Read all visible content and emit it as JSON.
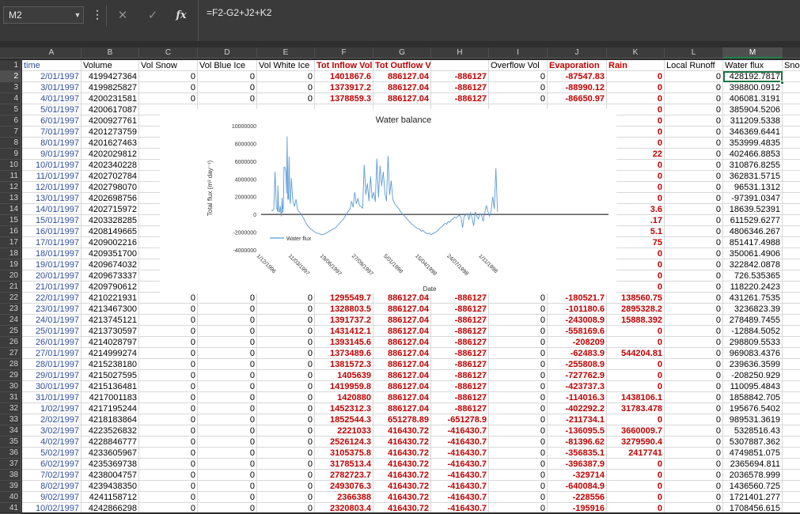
{
  "formula_bar": {
    "name_box": "M2",
    "more_icon": "ellipsis-vertical-icon",
    "cancel_icon": "cross-icon",
    "enter_icon": "check-icon",
    "fx_label": "fx",
    "formula": "=F2-G2+J2+K2"
  },
  "columns": [
    "A",
    "B",
    "C",
    "D",
    "E",
    "F",
    "G",
    "H",
    "I",
    "J",
    "K",
    "L",
    "M",
    ""
  ],
  "selected_column": "M",
  "headers": [
    "time",
    "Volume",
    "Vol Snow",
    "Vol Blue Ice",
    "Vol White Ice",
    "Tot Inflow Vol",
    "Tot Outflow Vol",
    "",
    "Overflow Vol",
    "Evaporation",
    "Rain",
    "Local Runoff",
    "Water flux",
    "Sno"
  ],
  "rows": [
    {
      "n": "2",
      "c": [
        "2/01/1997",
        "4199427364",
        "0",
        "0",
        "0",
        "1401867.6",
        "886127.04",
        "-886127",
        "0",
        "-87547.83",
        "0",
        "0",
        "428192.7817"
      ]
    },
    {
      "n": "3",
      "c": [
        "3/01/1997",
        "4199825827",
        "0",
        "0",
        "0",
        "1373917.2",
        "886127.04",
        "-886127",
        "0",
        "-88990.12",
        "0",
        "0",
        "398800.0912"
      ]
    },
    {
      "n": "4",
      "c": [
        "4/01/1997",
        "4200231581",
        "0",
        "0",
        "0",
        "1378859.3",
        "886127.04",
        "-886127",
        "0",
        "-86650.97",
        "0",
        "0",
        "406081.3191"
      ]
    },
    {
      "n": "5",
      "c": [
        "5/01/1997",
        "4200617087",
        "",
        "",
        "",
        "",
        "",
        "",
        "",
        "",
        "0",
        "0",
        "385904.5206"
      ]
    },
    {
      "n": "6",
      "c": [
        "6/01/1997",
        "4200927761",
        "",
        "",
        "",
        "",
        "",
        "",
        "",
        "",
        "0",
        "0",
        "311209.5338"
      ]
    },
    {
      "n": "7",
      "c": [
        "7/01/1997",
        "4201273759",
        "",
        "",
        "",
        "",
        "",
        "",
        "",
        "",
        "0",
        "0",
        "346369.6441"
      ]
    },
    {
      "n": "8",
      "c": [
        "8/01/1997",
        "4201627463",
        "",
        "",
        "",
        "",
        "",
        "",
        "",
        "",
        "0",
        "0",
        "353999.4835"
      ]
    },
    {
      "n": "9",
      "c": [
        "9/01/1997",
        "4202029812",
        "",
        "",
        "",
        "",
        "",
        "",
        "",
        "",
        "22",
        "0",
        "402466.8853"
      ]
    },
    {
      "n": "10",
      "c": [
        "10/01/1997",
        "4202340228",
        "",
        "",
        "",
        "",
        "",
        "",
        "",
        "",
        "0",
        "0",
        "310876.8255"
      ]
    },
    {
      "n": "11",
      "c": [
        "11/01/1997",
        "4202702784",
        "",
        "",
        "",
        "",
        "",
        "",
        "",
        "",
        "0",
        "0",
        "362831.5715"
      ]
    },
    {
      "n": "12",
      "c": [
        "12/01/1997",
        "4202798070",
        "",
        "",
        "",
        "",
        "",
        "",
        "",
        "",
        "0",
        "0",
        "96531.1312"
      ]
    },
    {
      "n": "13",
      "c": [
        "13/01/1997",
        "4202698756",
        "",
        "",
        "",
        "",
        "",
        "",
        "",
        "",
        "0",
        "0",
        "-97391.0347"
      ]
    },
    {
      "n": "14",
      "c": [
        "14/01/1997",
        "4202715972",
        "",
        "",
        "",
        "",
        "",
        "",
        "",
        "",
        "3.6",
        "0",
        "18639.52391"
      ]
    },
    {
      "n": "15",
      "c": [
        "15/01/1997",
        "4203328285",
        "",
        "",
        "",
        "",
        "",
        "",
        "",
        "",
        ".17",
        "0",
        "611529.6277"
      ]
    },
    {
      "n": "16",
      "c": [
        "16/01/1997",
        "4208149665",
        "",
        "",
        "",
        "",
        "",
        "",
        "",
        "",
        "5.1",
        "0",
        "4806346.267"
      ]
    },
    {
      "n": "17",
      "c": [
        "17/01/1997",
        "4209002216",
        "",
        "",
        "",
        "",
        "",
        "",
        "",
        "",
        "75",
        "0",
        "851417.4988"
      ]
    },
    {
      "n": "18",
      "c": [
        "18/01/1997",
        "4209351700",
        "",
        "",
        "",
        "",
        "",
        "",
        "",
        "",
        "0",
        "0",
        "350061.4906"
      ]
    },
    {
      "n": "19",
      "c": [
        "19/01/1997",
        "4209674032",
        "",
        "",
        "",
        "",
        "",
        "",
        "",
        "",
        "0",
        "0",
        "322842.0878"
      ]
    },
    {
      "n": "20",
      "c": [
        "20/01/1997",
        "4209673337",
        "",
        "",
        "",
        "",
        "",
        "",
        "",
        "",
        "0",
        "0",
        "726.535365"
      ]
    },
    {
      "n": "21",
      "c": [
        "21/01/1997",
        "4209790612",
        "",
        "",
        "",
        "",
        "",
        "",
        "",
        "",
        "0",
        "0",
        "118220.2423"
      ]
    },
    {
      "n": "22",
      "c": [
        "22/01/1997",
        "4210221931",
        "0",
        "0",
        "0",
        "1295549.7",
        "886127.04",
        "-886127",
        "0",
        "-180521.7",
        "138560.75",
        "0",
        "431261.7535"
      ]
    },
    {
      "n": "23",
      "c": [
        "23/01/1997",
        "4213467300",
        "0",
        "0",
        "0",
        "1328803.5",
        "886127.04",
        "-886127",
        "0",
        "-101180.6",
        "2895328.2",
        "0",
        "3236823.39"
      ]
    },
    {
      "n": "24",
      "c": [
        "24/01/1997",
        "4213745121",
        "0",
        "0",
        "0",
        "1391737.2",
        "886127.04",
        "-886127",
        "0",
        "-243008.9",
        "15888.392",
        "0",
        "278489.7455"
      ]
    },
    {
      "n": "25",
      "c": [
        "25/01/1997",
        "4213730597",
        "0",
        "0",
        "0",
        "1431412.1",
        "886127.04",
        "-886127",
        "0",
        "-558169.6",
        "0",
        "0",
        "-12884.5052"
      ]
    },
    {
      "n": "26",
      "c": [
        "26/01/1997",
        "4214028797",
        "0",
        "0",
        "0",
        "1393145.6",
        "886127.04",
        "-886127",
        "0",
        "-208209",
        "0",
        "0",
        "298809.5533"
      ]
    },
    {
      "n": "27",
      "c": [
        "27/01/1997",
        "4214999274",
        "0",
        "0",
        "0",
        "1373489.6",
        "886127.04",
        "-886127",
        "0",
        "-62483.9",
        "544204.81",
        "0",
        "969083.4376"
      ]
    },
    {
      "n": "28",
      "c": [
        "28/01/1997",
        "4215238180",
        "0",
        "0",
        "0",
        "1381572.3",
        "886127.04",
        "-886127",
        "0",
        "-255808.9",
        "0",
        "0",
        "239636.3599"
      ]
    },
    {
      "n": "29",
      "c": [
        "29/01/1997",
        "4215027595",
        "0",
        "0",
        "0",
        "1405639",
        "886127.04",
        "-886127",
        "0",
        "-727762.9",
        "0",
        "0",
        "-208250.929"
      ]
    },
    {
      "n": "30",
      "c": [
        "30/01/1997",
        "4215136481",
        "0",
        "0",
        "0",
        "1419959.8",
        "886127.04",
        "-886127",
        "0",
        "-423737.3",
        "0",
        "0",
        "110095.4843"
      ]
    },
    {
      "n": "31",
      "c": [
        "31/01/1997",
        "4217001183",
        "0",
        "0",
        "0",
        "1420880",
        "886127.04",
        "-886127",
        "0",
        "-114016.3",
        "1438106.1",
        "0",
        "1858842.705"
      ]
    },
    {
      "n": "32",
      "c": [
        "1/02/1997",
        "4217195244",
        "0",
        "0",
        "0",
        "1452312.3",
        "886127.04",
        "-886127",
        "0",
        "-402292.2",
        "31783.478",
        "0",
        "195676.5402"
      ]
    },
    {
      "n": "33",
      "c": [
        "2/02/1997",
        "4218183864",
        "0",
        "0",
        "0",
        "1852544.3",
        "651278.89",
        "-651278.9",
        "0",
        "-211734.1",
        "0",
        "0",
        "989531.3619"
      ]
    },
    {
      "n": "34",
      "c": [
        "3/02/1997",
        "4223526832",
        "0",
        "0",
        "0",
        "2221033",
        "416430.72",
        "-416430.7",
        "0",
        "-136095.5",
        "3660009.7",
        "0",
        "5328516.43"
      ]
    },
    {
      "n": "35",
      "c": [
        "4/02/1997",
        "4228846777",
        "0",
        "0",
        "0",
        "2526124.3",
        "416430.72",
        "-416430.7",
        "0",
        "-81396.62",
        "3279590.4",
        "0",
        "5307887.362"
      ]
    },
    {
      "n": "36",
      "c": [
        "5/02/1997",
        "4233605967",
        "0",
        "0",
        "0",
        "3105375.8",
        "416430.72",
        "-416430.7",
        "0",
        "-356835.1",
        "2417741",
        "0",
        "4749851.075"
      ]
    },
    {
      "n": "37",
      "c": [
        "6/02/1997",
        "4235369738",
        "0",
        "0",
        "0",
        "3178513.4",
        "416430.72",
        "-416430.7",
        "0",
        "-396387.9",
        "0",
        "0",
        "2365694.811"
      ]
    },
    {
      "n": "38",
      "c": [
        "7/02/1997",
        "4238004757",
        "0",
        "0",
        "0",
        "2782723.7",
        "416430.72",
        "-416430.7",
        "0",
        "-329714",
        "0",
        "0",
        "2036578.999"
      ]
    },
    {
      "n": "39",
      "c": [
        "8/02/1997",
        "4239438350",
        "0",
        "0",
        "0",
        "2493076.3",
        "416430.72",
        "-416430.7",
        "0",
        "-640084.9",
        "0",
        "0",
        "1436560.725"
      ]
    },
    {
      "n": "40",
      "c": [
        "9/02/1997",
        "4241158712",
        "0",
        "0",
        "0",
        "2366388",
        "416430.72",
        "-416430.7",
        "0",
        "-228556",
        "0",
        "0",
        "1721401.277"
      ]
    },
    {
      "n": "41",
      "c": [
        "10/02/1997",
        "4242866298",
        "0",
        "0",
        "0",
        "2320803.4",
        "416430.72",
        "-416430.7",
        "0",
        "-195916",
        "0",
        "0",
        "1708456.615"
      ]
    }
  ],
  "chart_data": {
    "type": "line",
    "title": "Water balance",
    "xlabel": "Date",
    "ylabel": "Total flux (m³ day⁻¹)",
    "ylim": [
      -4000000,
      10000000
    ],
    "yticks": [
      "10000000",
      "8000000",
      "6000000",
      "4000000",
      "2000000",
      "0",
      "-2000000",
      "-4000000"
    ],
    "yticks_values": [
      10000000,
      8000000,
      6000000,
      4000000,
      2000000,
      0,
      -2000000,
      -4000000
    ],
    "xticks": [
      "1/12/1996",
      "11/03/1997",
      "19/06/1997",
      "27/09/1997",
      "5/01/1998",
      "15/04/1998",
      "24/07/1998",
      "1/11/1998"
    ],
    "xlim_days": [
      0,
      1095
    ],
    "xtick_days": [
      0,
      100,
      200,
      300,
      400,
      500,
      600,
      700
    ],
    "legend_position": "bottom-left",
    "series": [
      {
        "name": "Water flux",
        "color": "#5b9bd5",
        "x_days": [
          32,
          36,
          40,
          44,
          48,
          52,
          53,
          55,
          58,
          60,
          62,
          64,
          66,
          68,
          70,
          72,
          75,
          78,
          80,
          82,
          84,
          86,
          88,
          90,
          92,
          95,
          100,
          105,
          110,
          115,
          120,
          125,
          130,
          135,
          140,
          145,
          150,
          155,
          160,
          165,
          170,
          175,
          180,
          185,
          190,
          195,
          200,
          205,
          210,
          215,
          220,
          225,
          230,
          235,
          240,
          245,
          250,
          255,
          260,
          265,
          270,
          275,
          280,
          285,
          290,
          295,
          300,
          305,
          310,
          315,
          320,
          325,
          330,
          335,
          340,
          345,
          350,
          355,
          360,
          365,
          370,
          375,
          380,
          385,
          390,
          395,
          400,
          405,
          410,
          415,
          420,
          425,
          430,
          435,
          440,
          445,
          450,
          455,
          460,
          465,
          470,
          475,
          480,
          485,
          490,
          495,
          500,
          505,
          510,
          515,
          520,
          525,
          530,
          535,
          540,
          545,
          550,
          555,
          560,
          565,
          570,
          575,
          580,
          585,
          590,
          595,
          600,
          605,
          610,
          615,
          620,
          625,
          630,
          635,
          640,
          645,
          650,
          655,
          660,
          665,
          670,
          675,
          680,
          685,
          690,
          695,
          700,
          705,
          710,
          715,
          720,
          725,
          730,
          735,
          740,
          745,
          748,
          750
        ],
        "y": [
          400000,
          428192,
          611529,
          4806346,
          851417,
          350061,
          3236823,
          278489,
          298809,
          969083,
          239636,
          -208250,
          1858842,
          195676,
          989531,
          5328516,
          5307887,
          4749851,
          2365694,
          8800000,
          1721401,
          1708456,
          6500000,
          2000000,
          1200000,
          4100000,
          1500000,
          900000,
          1700000,
          500000,
          300000,
          100000,
          -200000,
          -500000,
          -900000,
          -1200000,
          -1400000,
          -1600000,
          -1700000,
          -1900000,
          -2000000,
          -2100000,
          -2150000,
          -2200000,
          -2300000,
          -2250000,
          -2200000,
          -2100000,
          -2000000,
          -1900000,
          -1800000,
          -1700000,
          -1600000,
          -1500000,
          -1300000,
          -1100000,
          -900000,
          -700000,
          -500000,
          -200000,
          100000,
          400000,
          600000,
          1500000,
          800000,
          2500000,
          1200000,
          1800000,
          1000000,
          900000,
          700000,
          5600000,
          2200000,
          3500000,
          1500000,
          4300000,
          1800000,
          2500000,
          1400000,
          6300000,
          1900000,
          5500000,
          3200000,
          4800000,
          2400000,
          1500000,
          6600000,
          2200000,
          3800000,
          1700000,
          1300000,
          1000000,
          800000,
          600000,
          300000,
          100000,
          -100000,
          -300000,
          -500000,
          -700000,
          -900000,
          -1100000,
          -1200000,
          -1400000,
          -1500000,
          -1600000,
          -1700000,
          -1900000,
          -1800000,
          -2000000,
          -2100000,
          -2200000,
          -2100000,
          -2300000,
          -2200000,
          -2100000,
          -2000000,
          -1900000,
          -1700000,
          -1500000,
          -1400000,
          -1200000,
          -1000000,
          -1100000,
          -800000,
          -900000,
          -600000,
          -500000,
          -300000,
          -400000,
          -200000,
          -100000,
          -300000,
          -1500000,
          -200000,
          -100000,
          100000,
          -600000,
          200000,
          -400000,
          -1300000,
          300000,
          -200000,
          -500000,
          100000,
          -100000,
          -800000,
          200000,
          1000000,
          300000,
          -200000,
          400000,
          2000000,
          600000,
          5200000,
          300000
        ]
      }
    ]
  }
}
